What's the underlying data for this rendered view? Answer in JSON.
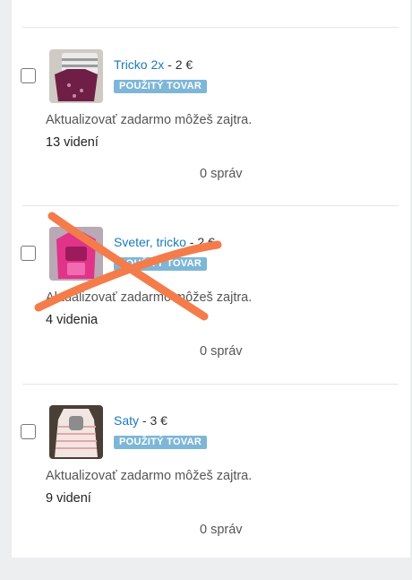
{
  "listings": [
    {
      "title": "Tricko 2x",
      "price": " - 2 €",
      "badge": "POUŽITÝ TOVAR",
      "note": "Aktualizovať zadarmo môžeš zajtra.",
      "views": "13 videní",
      "messages": "0 správ",
      "thumb_icon": "pink-kids-clothes-photo"
    },
    {
      "title": "Sveter, tricko",
      "price": " - 2 €",
      "badge": "POUŽITÝ TOVAR",
      "note": "Aktualizovať zadarmo môžeš zajtra.",
      "views": "4 videnia",
      "messages": "0 správ",
      "thumb_icon": "pink-sweater-photo",
      "crossed_out": true
    },
    {
      "title": "Saty",
      "price": " - 3 €",
      "badge": "POUŽITÝ TOVAR",
      "note": "Aktualizovať zadarmo môžeš zajtra.",
      "views": "9 videní",
      "messages": "0 správ",
      "thumb_icon": "striped-dress-photo"
    }
  ],
  "colors": {
    "link": "#1a7bb9",
    "badge": "#7eb6d7",
    "cross": "#f47c4a"
  }
}
